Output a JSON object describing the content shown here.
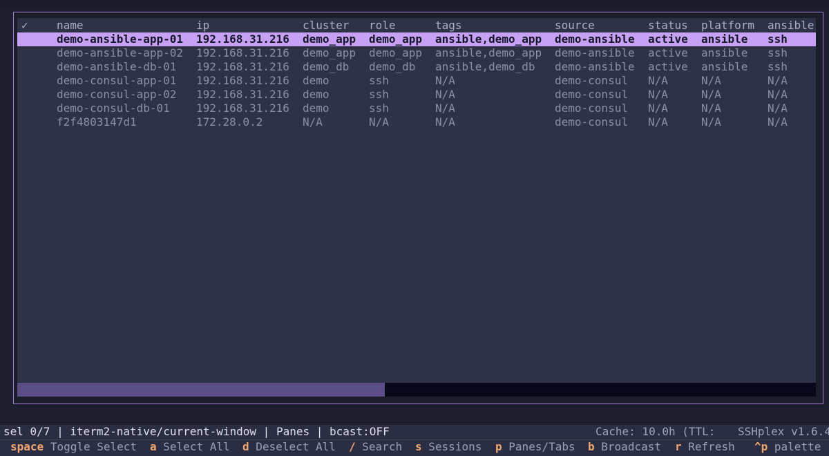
{
  "table": {
    "select_header": "✓",
    "columns": [
      "name",
      "ip",
      "cluster",
      "role",
      "tags",
      "source",
      "status",
      "platform",
      "ansible"
    ],
    "rows": [
      {
        "name": "demo-ansible-app-01",
        "ip": "192.168.31.216",
        "cluster": "demo_app",
        "role": "demo_app",
        "tags": "ansible,demo_app",
        "source": "demo-ansible",
        "status": "active",
        "platform": "ansible",
        "ansible": "ssh"
      },
      {
        "name": "demo-ansible-app-02",
        "ip": "192.168.31.216",
        "cluster": "demo_app",
        "role": "demo_app",
        "tags": "ansible,demo_app",
        "source": "demo-ansible",
        "status": "active",
        "platform": "ansible",
        "ansible": "ssh"
      },
      {
        "name": "demo-ansible-db-01",
        "ip": "192.168.31.216",
        "cluster": "demo_db",
        "role": "demo_db",
        "tags": "ansible,demo_db",
        "source": "demo-ansible",
        "status": "active",
        "platform": "ansible",
        "ansible": "ssh"
      },
      {
        "name": "demo-consul-app-01",
        "ip": "192.168.31.216",
        "cluster": "demo",
        "role": "ssh",
        "tags": "N/A",
        "source": "demo-consul",
        "status": "N/A",
        "platform": "N/A",
        "ansible": "N/A"
      },
      {
        "name": "demo-consul-app-02",
        "ip": "192.168.31.216",
        "cluster": "demo",
        "role": "ssh",
        "tags": "N/A",
        "source": "demo-consul",
        "status": "N/A",
        "platform": "N/A",
        "ansible": "N/A"
      },
      {
        "name": "demo-consul-db-01",
        "ip": "192.168.31.216",
        "cluster": "demo",
        "role": "ssh",
        "tags": "N/A",
        "source": "demo-consul",
        "status": "N/A",
        "platform": "N/A",
        "ansible": "N/A"
      },
      {
        "name": "f2f4803147d1",
        "ip": "172.28.0.2",
        "cluster": "N/A",
        "role": "N/A",
        "tags": "N/A",
        "source": "demo-consul",
        "status": "N/A",
        "platform": "N/A",
        "ansible": "N/A"
      }
    ],
    "highlighted_row": 0,
    "horizontal_scroll_fraction": 0.46
  },
  "status_bar": {
    "left": "sel 0/7 | iterm2-native/current-window | Panes | bcast:OFF",
    "cache": "Cache: 10.0h (TTL:",
    "version": "SSHplex v1.6.4"
  },
  "footer": {
    "bindings": [
      {
        "key": "space",
        "label": "Toggle Select"
      },
      {
        "key": "a",
        "label": "Select All"
      },
      {
        "key": "d",
        "label": "Deselect All"
      },
      {
        "key": "/",
        "label": "Search"
      },
      {
        "key": "s",
        "label": "Sessions"
      },
      {
        "key": "p",
        "label": "Panes/Tabs"
      },
      {
        "key": "b",
        "label": "Broadcast"
      },
      {
        "key": "r",
        "label": "Refresh"
      }
    ],
    "palette": {
      "key": "^p",
      "label": "palette"
    }
  },
  "colors": {
    "highlight": "#c7a1f4",
    "accent_key": "#f0a66f",
    "panel_border": "#9d82d4",
    "background": "#2e3246"
  }
}
